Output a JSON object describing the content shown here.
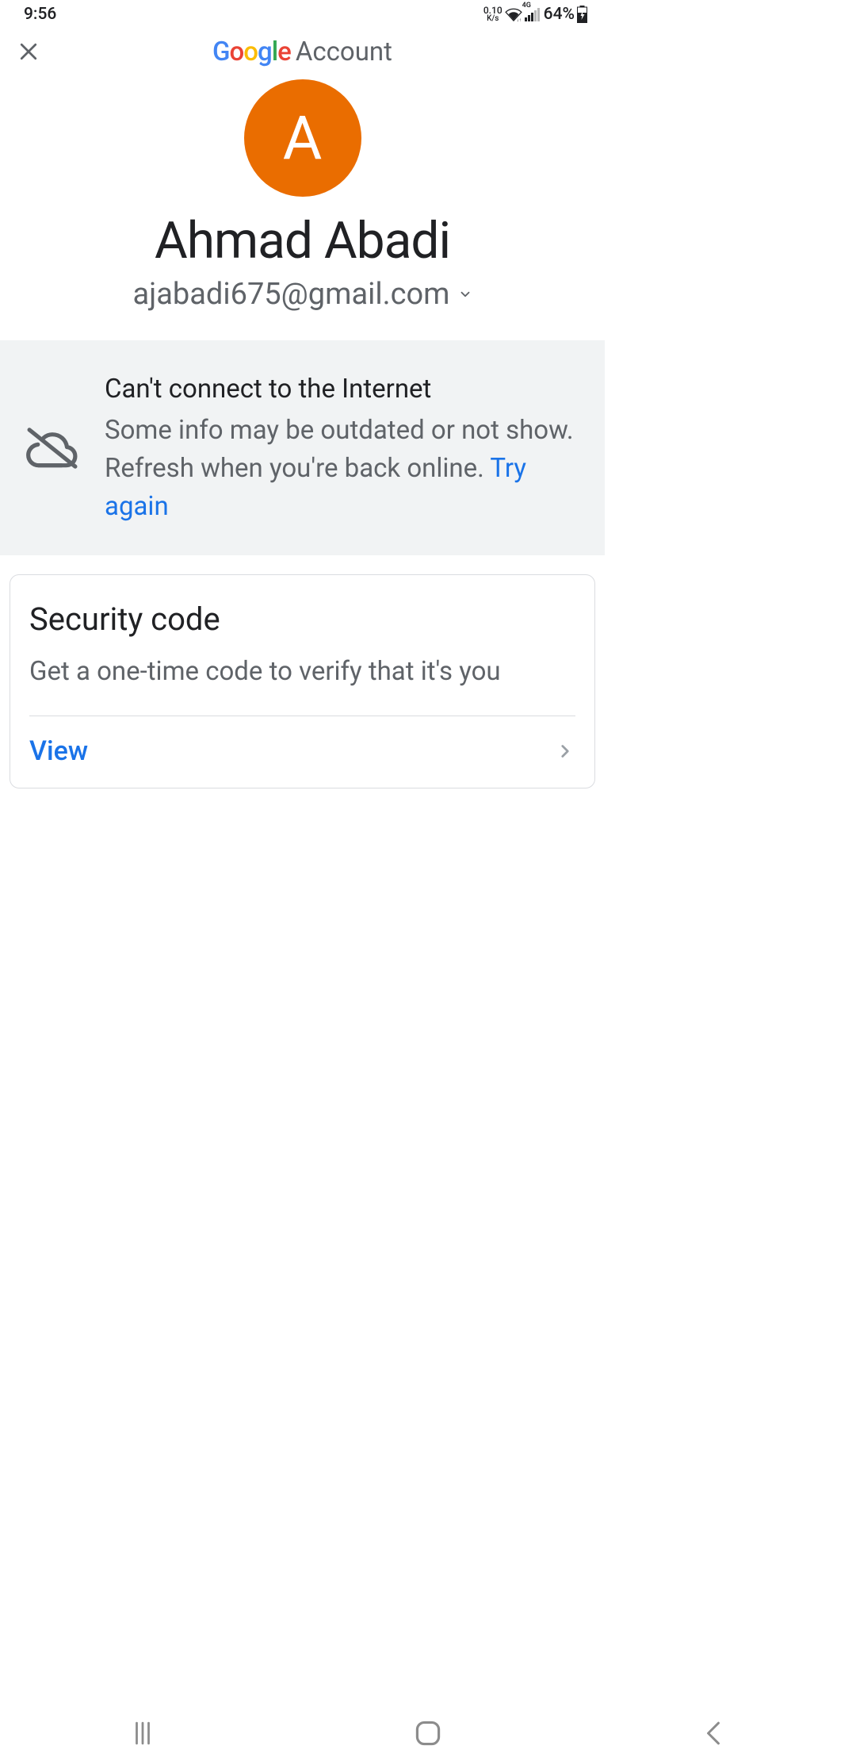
{
  "status": {
    "time": "9:56",
    "net_speed_top": "0.10",
    "net_speed_bottom": "K/s",
    "mobile_label": "4G",
    "battery_pct": "64%"
  },
  "header": {
    "google_word": "Google",
    "account_word": "Account"
  },
  "profile": {
    "avatar_initial": "A",
    "avatar_color": "#EA6D00",
    "display_name": "Ahmad Abadi",
    "email": "ajabadi675@gmail.com"
  },
  "banner": {
    "title": "Can't connect to the Internet",
    "message": "Some info may be outdated or not show. Refresh when you're back online. ",
    "action_label": "Try again"
  },
  "security_card": {
    "title": "Security code",
    "description": "Get a one-time code to verify that it's you",
    "action_label": "View"
  }
}
